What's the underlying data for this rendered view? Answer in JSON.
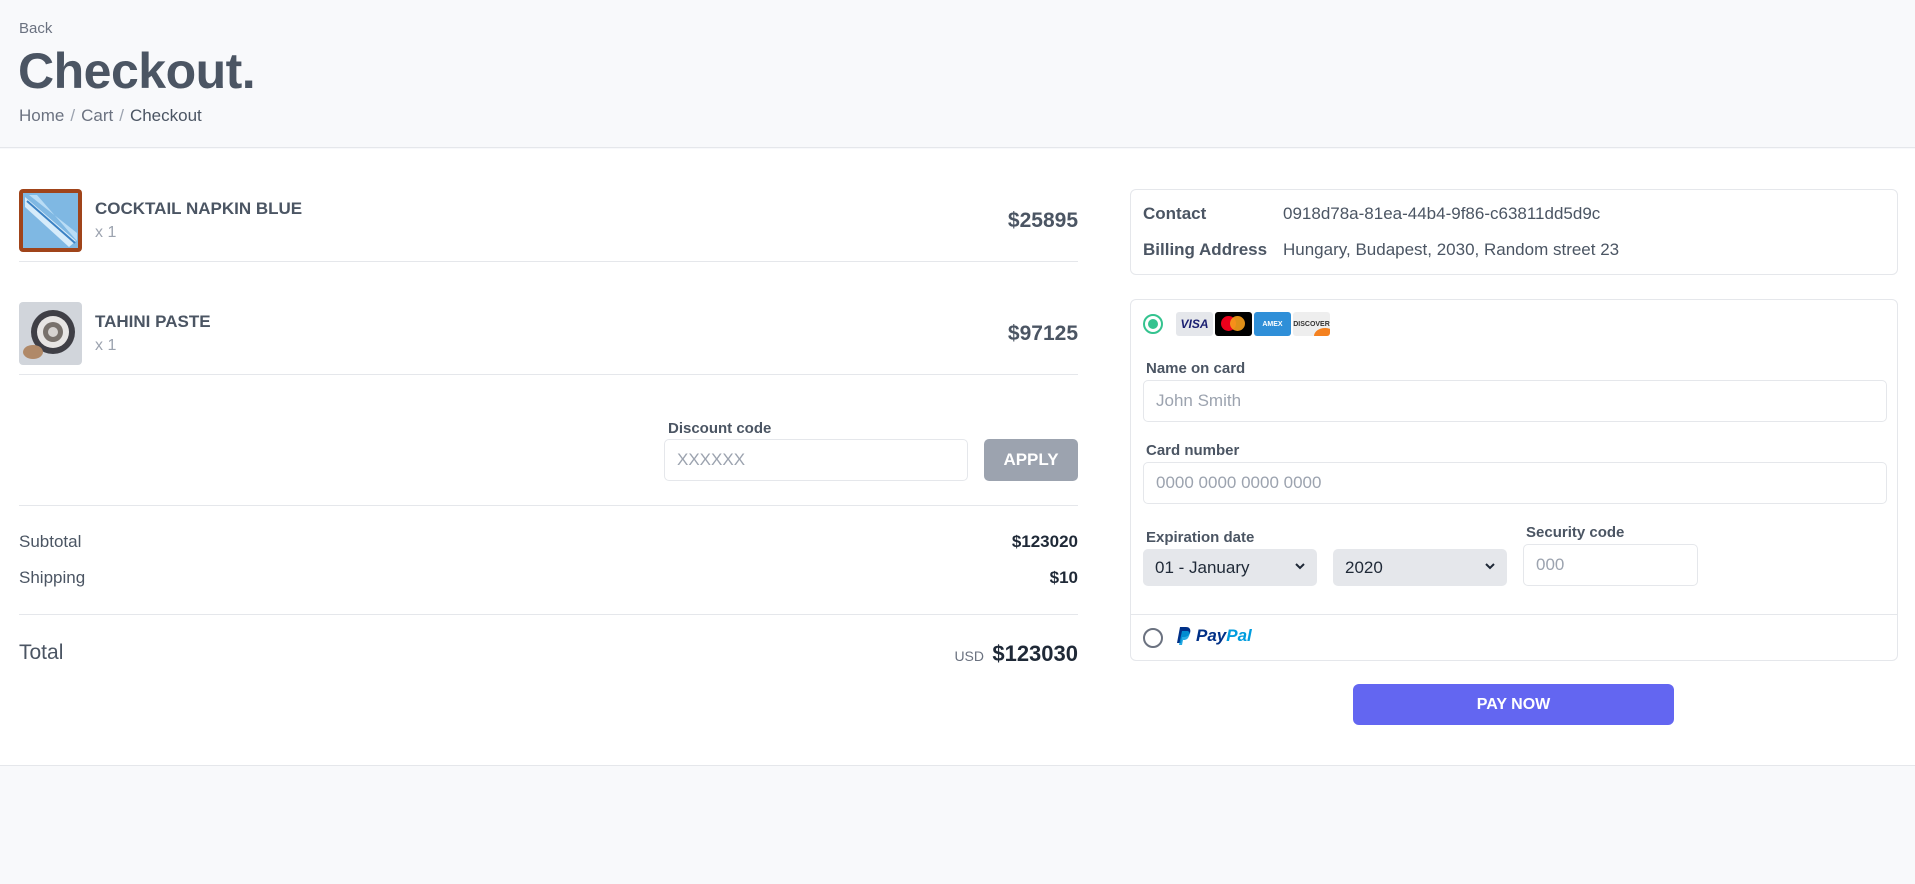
{
  "header": {
    "back_label": "Back",
    "title": "Checkout.",
    "breadcrumb": {
      "home": "Home",
      "cart": "Cart",
      "current": "Checkout",
      "separator": "/"
    }
  },
  "items": [
    {
      "name": "COCKTAIL NAPKIN BLUE",
      "qty": "x 1",
      "price": "$25895"
    },
    {
      "name": "TAHINI PASTE",
      "qty": "x 1",
      "price": "$97125"
    }
  ],
  "discount": {
    "label": "Discount code",
    "placeholder": "XXXXXX",
    "apply_label": "APPLY"
  },
  "totals": {
    "subtotal_label": "Subtotal",
    "subtotal": "$123020",
    "shipping_label": "Shipping",
    "shipping": "$10",
    "total_label": "Total",
    "currency": "USD",
    "total": "$123030"
  },
  "contact": {
    "contact_label": "Contact",
    "contact_value": "0918d78a-81ea-44b4-9f86-c63811dd5d9c",
    "billing_label": "Billing Address",
    "billing_value": "Hungary, Budapest, 2030, Random street 23"
  },
  "payment": {
    "card_option_selected": true,
    "card_brands": [
      "VISA",
      "mastercard",
      "AMERICAN EXPRESS",
      "DISCOVER"
    ],
    "name_label": "Name on card",
    "name_placeholder": "John Smith",
    "number_label": "Card number",
    "number_placeholder": "0000 0000 0000 0000",
    "expiration_label": "Expiration date",
    "month_value": "01 - January",
    "year_value": "2020",
    "security_label": "Security code",
    "security_placeholder": "000",
    "paypal": {
      "pay": "Pay",
      "pal": "Pal"
    },
    "pay_now_label": "PAY NOW"
  },
  "colors": {
    "accent": "#6366f1",
    "radio_selected": "#34c38f",
    "apply_bg": "#9ca3af"
  }
}
